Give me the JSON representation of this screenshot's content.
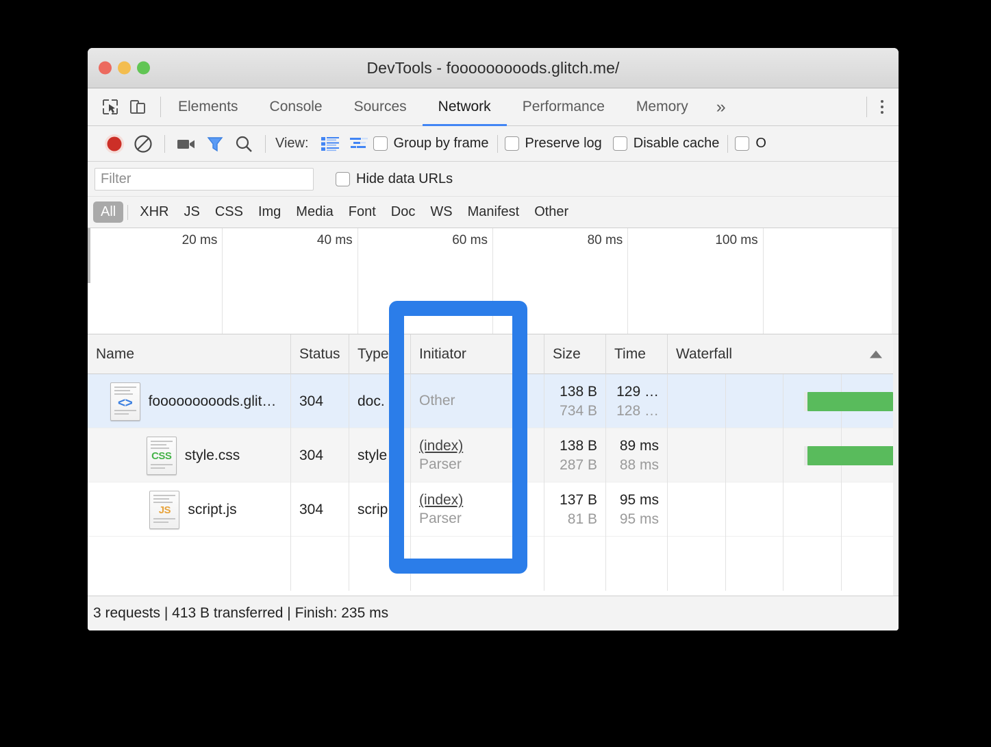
{
  "window": {
    "title": "DevTools - fooooooooods.glitch.me/",
    "traffic_lights": [
      "close",
      "minimize",
      "zoom"
    ]
  },
  "panel_tabs": {
    "icons": [
      {
        "name": "inspect-element-icon",
        "glyph": "inspect"
      },
      {
        "name": "device-toolbar-icon",
        "glyph": "device"
      }
    ],
    "items": [
      {
        "label": "Elements",
        "active": false
      },
      {
        "label": "Console",
        "active": false
      },
      {
        "label": "Sources",
        "active": false
      },
      {
        "label": "Network",
        "active": true
      },
      {
        "label": "Performance",
        "active": false
      },
      {
        "label": "Memory",
        "active": false
      }
    ],
    "more_label": "»",
    "menu_icon": "kebab-menu-icon"
  },
  "network_toolbar": {
    "record_icon": "record-button-icon",
    "clear_icon": "clear-icon",
    "screenshot_icon": "camera-icon",
    "filter_icon": "funnel-filter-icon",
    "search_icon": "search-icon",
    "view_label": "View:",
    "view_list_icon": "list-view-icon",
    "view_waterfall_icon": "waterfall-view-icon",
    "checkboxes": [
      {
        "label": "Group by frame",
        "checked": false
      },
      {
        "label": "Preserve log",
        "checked": false
      },
      {
        "label": "Disable cache",
        "checked": false
      },
      {
        "label": "O",
        "checked": false,
        "clipped": true
      }
    ]
  },
  "filter_row": {
    "input_value": "",
    "input_placeholder": "Filter",
    "hide_data_urls": {
      "label": "Hide data URLs",
      "checked": false
    }
  },
  "type_filters": {
    "all_label": "All",
    "items": [
      "XHR",
      "JS",
      "CSS",
      "Img",
      "Media",
      "Font",
      "Doc",
      "WS",
      "Manifest",
      "Other"
    ],
    "selected": "All"
  },
  "overview": {
    "ticks": [
      "20 ms",
      "40 ms",
      "60 ms",
      "80 ms",
      "100 ms"
    ]
  },
  "table": {
    "headers": [
      "Name",
      "Status",
      "Type",
      "Initiator",
      "Size",
      "Time",
      "Waterfall"
    ],
    "sort_column": "Waterfall",
    "sort_direction": "ascending",
    "rows": [
      {
        "icon": "document-file-icon",
        "icon_badge": "<>",
        "name": "fooooooooods.glit…",
        "status": "304",
        "type": "doc.",
        "initiator_main": "Other",
        "initiator_sub": "",
        "initiator_is_link": false,
        "size": "138 B",
        "size_sub": "734 B",
        "time": "129 …",
        "time_sub": "128 …",
        "selected": true,
        "waterfall_bar": null
      },
      {
        "icon": "css-file-icon",
        "icon_badge": "CSS",
        "name": "style.css",
        "status": "304",
        "type": "style…",
        "initiator_main": "(index)",
        "initiator_sub": "Parser",
        "initiator_is_link": true,
        "size": "138 B",
        "size_sub": "287 B",
        "time": "89 ms",
        "time_sub": "88 ms",
        "selected": false,
        "waterfall_bar": {
          "left_pct": 60.5,
          "width_pct": 37.5
        }
      },
      {
        "icon": "js-file-icon",
        "icon_badge": "JS",
        "name": "script.js",
        "status": "304",
        "type": "scrip…",
        "initiator_main": "(index)",
        "initiator_sub": "Parser",
        "initiator_is_link": true,
        "size": "137 B",
        "size_sub": "81 B",
        "time": "95 ms",
        "time_sub": "95 ms",
        "selected": false,
        "waterfall_bar": null
      }
    ],
    "row1_waterfall_bar": {
      "left_pct": 60.5,
      "width_pct": 37.0
    }
  },
  "status_bar": {
    "text": "3 requests | 413 B transferred | Finish: 235 ms"
  },
  "annotation": {
    "name": "initiator-column-highlight",
    "color": "#2b7de9"
  }
}
